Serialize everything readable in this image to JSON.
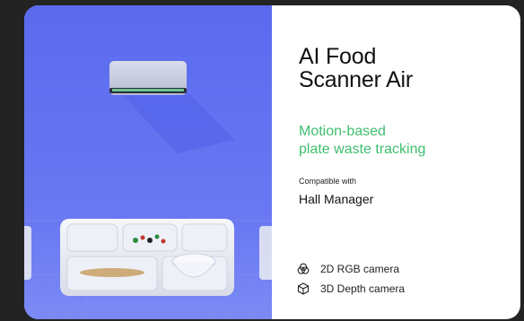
{
  "product": {
    "title_line1": "AI Food",
    "title_line2": "Scanner Air",
    "subtitle_line1": "Motion-based",
    "subtitle_line2": "plate waste tracking",
    "compatible_label": "Compatible with",
    "compatible_value": "Hall Manager"
  },
  "features": [
    {
      "label": "2D RGB camera",
      "icon": "rgb-camera-icon"
    },
    {
      "label": "3D Depth camera",
      "icon": "depth-camera-icon"
    }
  ],
  "colors": {
    "background": "#232323",
    "card": "#ffffff",
    "accent_green": "#3fbf6e",
    "photo_blue": "#6573f1"
  }
}
